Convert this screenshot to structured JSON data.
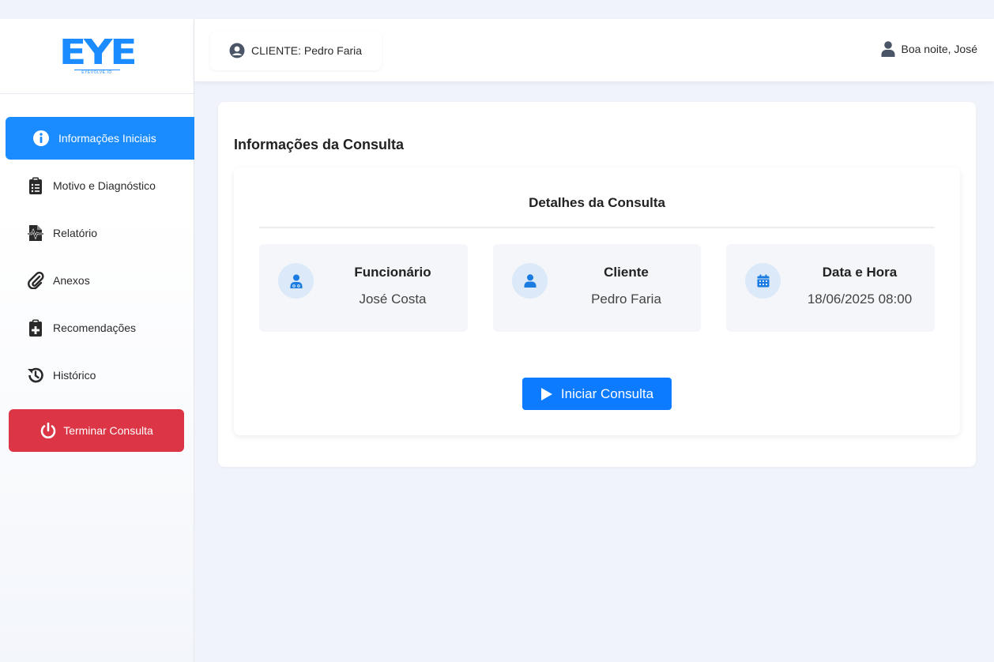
{
  "brand": {
    "logo_text": "EYE",
    "logo_subtext": "EYEVOLVE.IO"
  },
  "sidebar": {
    "items": [
      {
        "label": "Informações Iniciais",
        "icon": "info-circle-icon",
        "active": true
      },
      {
        "label": "Motivo e Diagnóstico",
        "icon": "clipboard-list-icon"
      },
      {
        "label": "Relatório",
        "icon": "file-waveform-icon"
      },
      {
        "label": "Anexos",
        "icon": "paperclip-icon"
      },
      {
        "label": "Recomendações",
        "icon": "clipboard-plus-icon"
      },
      {
        "label": "Histórico",
        "icon": "history-icon"
      }
    ],
    "terminate_label": "Terminar Consulta"
  },
  "topbar": {
    "client_label": "CLIENTE: Pedro Faria",
    "greeting": "Boa noite, José"
  },
  "main": {
    "section_title": "Informações da Consulta",
    "details_title": "Detalhes da Consulta",
    "cards": [
      {
        "label": "Funcionário",
        "value": "José Costa",
        "icon": "user-doctor-icon"
      },
      {
        "label": "Cliente",
        "value": "Pedro Faria",
        "icon": "user-icon"
      },
      {
        "label": "Data e Hora",
        "value": "18/06/2025 08:00",
        "icon": "calendar-icon"
      }
    ],
    "start_button": "Iniciar Consulta"
  },
  "colors": {
    "accent": "#1a8cff",
    "danger": "#dc3545",
    "button_primary": "#0d7bff",
    "icon_circle": "#dbe9f9"
  }
}
